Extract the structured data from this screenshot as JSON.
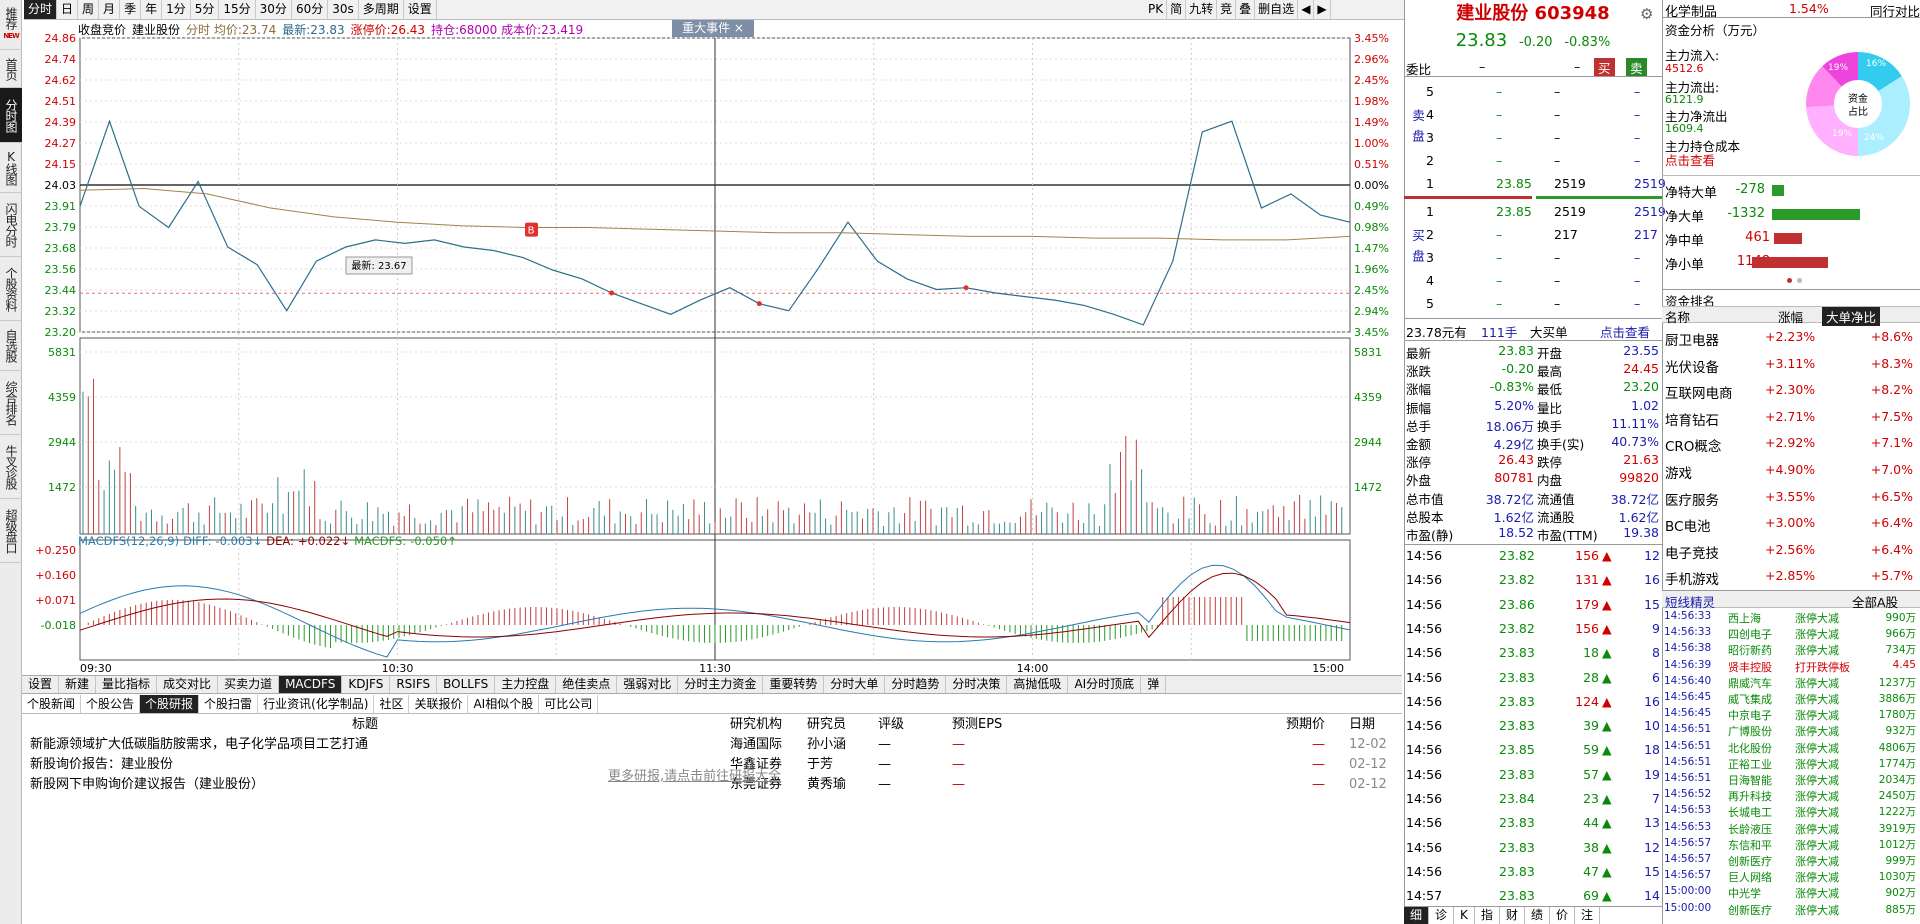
{
  "leftnav": [
    "推荐",
    "首页",
    "分时图",
    "K线图",
    "闪电分时",
    "个股资料",
    "自选股",
    "综合排名",
    "牛叉诊股",
    "超级盘口"
  ],
  "leftnav_new": "NEW",
  "toolbar": [
    "分时",
    "日",
    "周",
    "月",
    "季",
    "年",
    "1分",
    "5分",
    "15分",
    "30分",
    "60分",
    "30s",
    "多周期",
    "设置"
  ],
  "toolbar_right": [
    "PK",
    "简",
    "九转",
    "竞",
    "叠",
    "删自选",
    "◀",
    "▶"
  ],
  "chart": {
    "header_title": "收盘竞价",
    "stock_name": "建业股份",
    "avg_label": "分时 均价:",
    "avg_value": "23.74",
    "last_label": "最新:",
    "last_value": "23.83",
    "limit_label": "涨停价:",
    "limit_value": "26.43",
    "hold_label": "持仓:",
    "hold_value": "68000",
    "cost_label": "成本价:",
    "cost_value": "23.419",
    "event": "重大事件 ×",
    "tooltip": "最新: 23.67",
    "b_marker": "B",
    "price_ticks": [
      "24.86",
      "24.74",
      "24.62",
      "24.51",
      "24.39",
      "24.27",
      "24.15",
      "24.03",
      "23.91",
      "23.79",
      "23.68",
      "23.56",
      "23.44",
      "23.32",
      "23.20"
    ],
    "pct_ticks": [
      "3.45%",
      "2.96%",
      "2.45%",
      "1.98%",
      "1.49%",
      "1.00%",
      "0.51%",
      "0.00%",
      "0.49%",
      "0.98%",
      "1.47%",
      "1.96%",
      "2.45%",
      "2.94%",
      "3.45%"
    ],
    "vol_ticks": [
      "5831",
      "4359",
      "2944",
      "1472"
    ],
    "macd_ticks": [
      "+0.250",
      "+0.160",
      "+0.071",
      "-0.018"
    ],
    "time_ticks": [
      "09:30",
      "10:30",
      "11:30",
      "14:00",
      "15:00"
    ],
    "macd_header": {
      "name": "MACDFS(12,26,9)",
      "diff_label": "DIFF:",
      "diff": "-0.003↓",
      "dea_label": "DEA:",
      "dea": "+0.022↓",
      "macdfs_label": "MACDFS:",
      "macdfs": "-0.050↑"
    }
  },
  "chart_data": {
    "type": "line",
    "title": "",
    "x": [
      "09:30",
      "10:30",
      "11:30",
      "14:00",
      "15:00"
    ],
    "ylim": [
      23.2,
      24.86
    ],
    "series": [
      {
        "name": "分时",
        "values": [
          23.91,
          24.39,
          23.91,
          23.79,
          24.05,
          23.68,
          23.58,
          23.32,
          23.6,
          23.68,
          23.72,
          23.7,
          23.72,
          23.68,
          23.66,
          23.62,
          23.55,
          23.5,
          23.42,
          23.36,
          23.3,
          23.38,
          23.45,
          23.36,
          23.32,
          23.56,
          23.82,
          23.6,
          23.5,
          23.44,
          23.45,
          23.42,
          23.4,
          23.38,
          23.35,
          23.3,
          23.24,
          23.6,
          24.33,
          24.39,
          23.9,
          23.98,
          23.86,
          23.82
        ]
      },
      {
        "name": "均价",
        "values": [
          24.0,
          24.01,
          23.98,
          23.9,
          23.85,
          23.82,
          23.8,
          23.79,
          23.79,
          23.78,
          23.77,
          23.76,
          23.76,
          23.75,
          23.74,
          23.74,
          23.73,
          23.73,
          23.72,
          23.72,
          23.74
        ]
      }
    ],
    "reference": {
      "prev_close": 24.03,
      "cost": 23.419
    }
  },
  "indicator_tabs": [
    "设置",
    "新建",
    "量比指标",
    "成交对比",
    "买卖力道",
    "MACDFS",
    "KDJFS",
    "RSIFS",
    "BOLLFS",
    "主力控盘",
    "绝佳卖点",
    "强弱对比",
    "分时主力资金",
    "重要转势",
    "分时大单",
    "分时趋势",
    "分时决策",
    "高抛低吸",
    "AI分时顶底",
    "弹"
  ],
  "news_tabs": [
    "个股新闻",
    "个股公告",
    "个股研报",
    "个股扫雷",
    "行业资讯(化学制品)",
    "社区",
    "关联报价",
    "AI相似个股",
    "可比公司"
  ],
  "news_headers": {
    "title": "标题",
    "org": "研究机构",
    "analyst": "研究员",
    "rating": "评级",
    "eps": "预测EPS",
    "target": "预期价",
    "date": "日期"
  },
  "news_rows": [
    {
      "title": "新能源领域扩大低碳脂肪胺需求，电子化学品项目工艺打通",
      "org": "海通国际",
      "analyst": "孙小涵",
      "rating": "—",
      "eps": "—",
      "target": "—",
      "date": "12-02"
    },
    {
      "title": "新股询价报告：建业股份",
      "org": "华鑫证券",
      "analyst": "于芳",
      "rating": "—",
      "eps": "—",
      "target": "—",
      "date": "02-12"
    },
    {
      "title": "新股网下申购询价建议报告（建业股份）",
      "org": "东莞证券",
      "analyst": "黄秀瑜",
      "rating": "—",
      "eps": "—",
      "target": "—",
      "date": "02-12"
    }
  ],
  "more_research": "更多研报,请点击前往研报大全",
  "quote": {
    "title": "建业股份 603948",
    "price": "23.83",
    "change": "-0.20",
    "pct": "-0.83%",
    "weibi_label": "委比",
    "weibi": "–",
    "weicha": "–",
    "buy_btn": "买",
    "sell_btn": "卖",
    "sell_side": "卖盘",
    "buy_side": "买盘",
    "asks": [
      {
        "n": "5",
        "p": "–",
        "v": "–"
      },
      {
        "n": "4",
        "p": "–",
        "v": "–"
      },
      {
        "n": "3",
        "p": "–",
        "v": "–"
      },
      {
        "n": "2",
        "p": "–",
        "v": "–"
      },
      {
        "n": "1",
        "p": "23.85",
        "v": "2519"
      }
    ],
    "bids": [
      {
        "n": "1",
        "p": "23.85",
        "v": "2519"
      },
      {
        "n": "2",
        "p": "–",
        "v": "217"
      },
      {
        "n": "3",
        "p": "–",
        "v": "–"
      },
      {
        "n": "4",
        "p": "–",
        "v": "–"
      },
      {
        "n": "5",
        "p": "–",
        "v": "–"
      }
    ],
    "big_order": {
      "price": "23.78元有",
      "qty": "111手",
      "label": "大买单",
      "link": "点击查看"
    },
    "stats": [
      [
        "最新",
        "23.83",
        "开盘",
        "23.55"
      ],
      [
        "涨跌",
        "-0.20",
        "最高",
        "24.45"
      ],
      [
        "涨幅",
        "-0.83%",
        "最低",
        "23.20"
      ],
      [
        "振幅",
        "5.20%",
        "量比",
        "1.02"
      ],
      [
        "总手",
        "18.06万",
        "换手",
        "11.11%"
      ],
      [
        "金额",
        "4.29亿",
        "换手(实)",
        "40.73%"
      ],
      [
        "涨停",
        "26.43",
        "跌停",
        "21.63"
      ],
      [
        "外盘",
        "80781",
        "内盘",
        "99820"
      ],
      [
        "总市值",
        "38.72亿",
        "流通值",
        "38.72亿"
      ],
      [
        "总股本",
        "1.62亿",
        "流通股",
        "1.62亿"
      ],
      [
        "市盈(静)",
        "18.52",
        "市盈(TTM)",
        "19.38"
      ]
    ],
    "ticks": [
      {
        "t": "14:56",
        "p": "23.82",
        "v": "156",
        "d": "12"
      },
      {
        "t": "14:56",
        "p": "23.82",
        "v": "131",
        "d": "16"
      },
      {
        "t": "14:56",
        "p": "23.86",
        "v": "179",
        "d": "15"
      },
      {
        "t": "14:56",
        "p": "23.82",
        "v": "156",
        "d": "9"
      },
      {
        "t": "14:56",
        "p": "23.83",
        "v": "18",
        "d": "8"
      },
      {
        "t": "14:56",
        "p": "23.83",
        "v": "28",
        "d": "6"
      },
      {
        "t": "14:56",
        "p": "23.83",
        "v": "124",
        "d": "16"
      },
      {
        "t": "14:56",
        "p": "23.83",
        "v": "39",
        "d": "10"
      },
      {
        "t": "14:56",
        "p": "23.85",
        "v": "59",
        "d": "18"
      },
      {
        "t": "14:56",
        "p": "23.83",
        "v": "57",
        "d": "19"
      },
      {
        "t": "14:56",
        "p": "23.84",
        "v": "23",
        "d": "7"
      },
      {
        "t": "14:56",
        "p": "23.83",
        "v": "44",
        "d": "13"
      },
      {
        "t": "14:56",
        "p": "23.83",
        "v": "38",
        "d": "12"
      },
      {
        "t": "14:56",
        "p": "23.83",
        "v": "47",
        "d": "15"
      },
      {
        "t": "14:57",
        "p": "23.83",
        "v": "69",
        "d": "14"
      }
    ],
    "bottom_tabs": [
      "细",
      "诊",
      "K",
      "指",
      "财",
      "绩",
      "价",
      "注"
    ]
  },
  "sector": {
    "name": "化学制品",
    "pct": "1.54%",
    "peer": "同行对比",
    "flow_title": "资金分析（万元）",
    "inflow_label": "主力流入:",
    "inflow": "4512.6",
    "outflow_label": "主力流出:",
    "outflow": "6121.9",
    "net_label": "主力净流出",
    "net": "1609.4",
    "cost_label": "主力持仓成本",
    "cost_link": "点击查看",
    "pie_center": "资金占比",
    "pie_pcts": [
      "16%",
      "19%",
      "19%",
      "24%"
    ],
    "net_orders": [
      {
        "label": "净特大单",
        "v": "-278"
      },
      {
        "label": "净大单",
        "v": "-1332"
      },
      {
        "label": "净中单",
        "v": "461"
      },
      {
        "label": "净小单",
        "v": "1148"
      }
    ],
    "rank_title": "资金排名",
    "rank_headers": [
      "名称",
      "涨幅",
      "大单净比"
    ],
    "rank": [
      [
        "厨卫电器",
        "+2.23%",
        "+8.6%"
      ],
      [
        "光伏设备",
        "+3.11%",
        "+8.3%"
      ],
      [
        "互联网电商",
        "+2.30%",
        "+8.2%"
      ],
      [
        "培育钻石",
        "+2.71%",
        "+7.5%"
      ],
      [
        "CRO概念",
        "+2.92%",
        "+7.1%"
      ],
      [
        "游戏",
        "+4.90%",
        "+7.0%"
      ],
      [
        "医疗服务",
        "+3.55%",
        "+6.5%"
      ],
      [
        "BC电池",
        "+3.00%",
        "+6.4%"
      ],
      [
        "电子竞技",
        "+2.56%",
        "+6.4%"
      ],
      [
        "手机游戏",
        "+2.85%",
        "+5.7%"
      ]
    ],
    "spirit_title": "短线精灵",
    "spirit_filter": "全部A股",
    "spirit": [
      [
        "14:56:33",
        "西上海",
        "涨停大减",
        "990万"
      ],
      [
        "14:56:33",
        "四创电子",
        "涨停大减",
        "966万"
      ],
      [
        "14:56:38",
        "昭衍新药",
        "涨停大减",
        "734万"
      ],
      [
        "14:56:39",
        "贤丰控股",
        "打开跌停板",
        "4.45"
      ],
      [
        "14:56:40",
        "鼎威汽车",
        "涨停大减",
        "1237万"
      ],
      [
        "14:56:45",
        "威飞集成",
        "涨停大减",
        "3886万"
      ],
      [
        "14:56:45",
        "中京电子",
        "涨停大减",
        "1780万"
      ],
      [
        "14:56:51",
        "广博股份",
        "涨停大减",
        "932万"
      ],
      [
        "14:56:51",
        "北化股份",
        "涨停大减",
        "4806万"
      ],
      [
        "14:56:51",
        "正裕工业",
        "涨停大减",
        "1774万"
      ],
      [
        "14:56:51",
        "日海智能",
        "涨停大减",
        "2034万"
      ],
      [
        "14:56:52",
        "再升科技",
        "涨停大减",
        "2450万"
      ],
      [
        "14:56:53",
        "长城电工",
        "涨停大减",
        "1222万"
      ],
      [
        "14:56:53",
        "长龄液压",
        "涨停大减",
        "3919万"
      ],
      [
        "14:56:57",
        "东信和平",
        "涨停大减",
        "1012万"
      ],
      [
        "14:56:57",
        "创新医疗",
        "涨停大减",
        "999万"
      ],
      [
        "14:56:57",
        "巨人网络",
        "涨停大减",
        "1030万"
      ],
      [
        "15:00:00",
        "中光学",
        "涨停大减",
        "902万"
      ],
      [
        "15:00:00",
        "创新医疗",
        "涨停大减",
        "885万"
      ]
    ]
  }
}
